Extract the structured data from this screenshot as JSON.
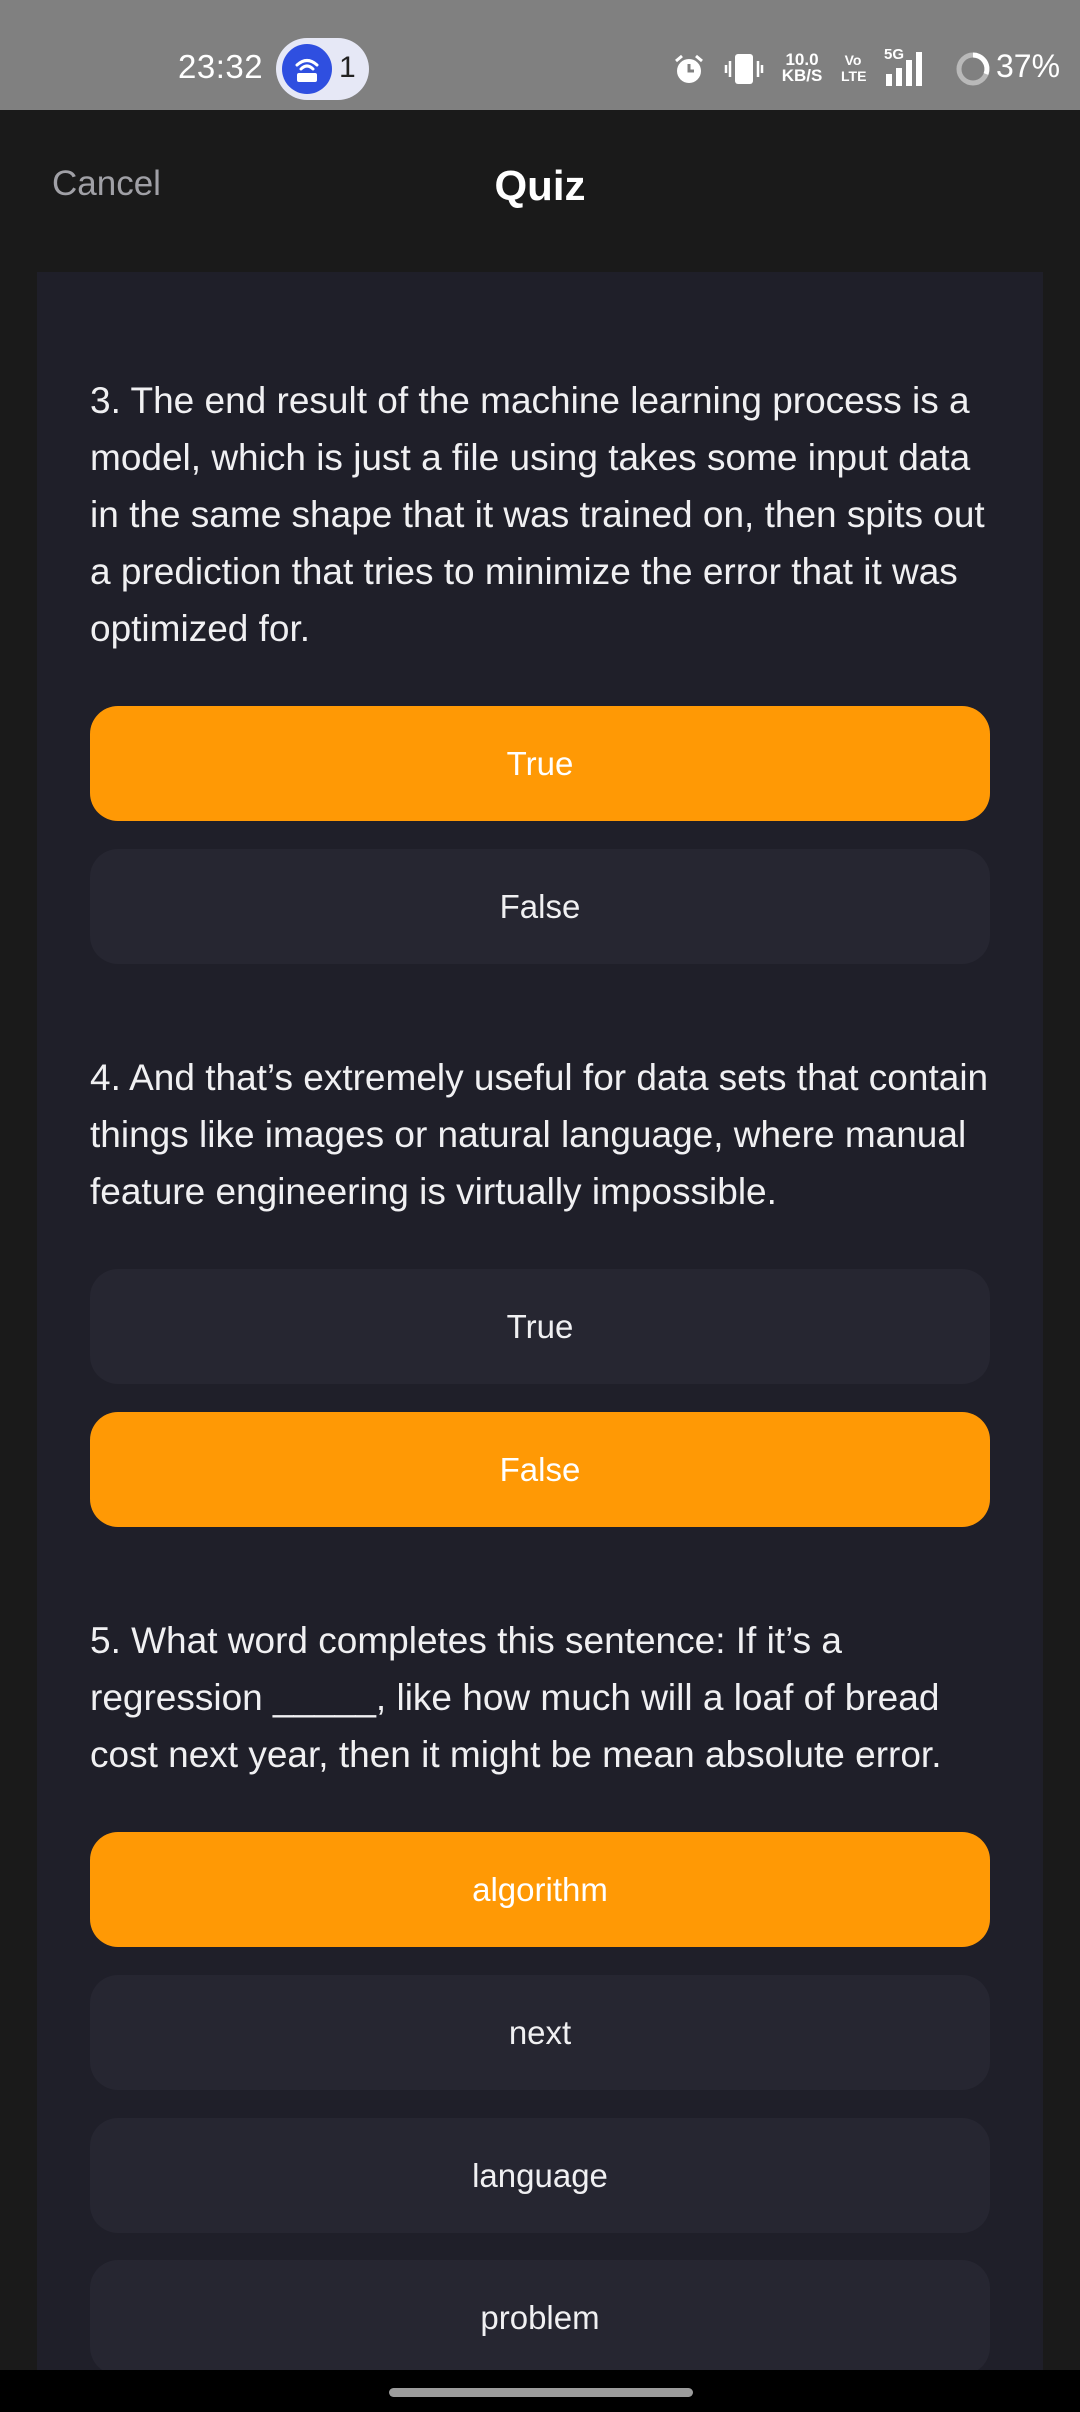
{
  "status_bar": {
    "time": "23:32",
    "hotspot_count": "1",
    "net_speed_value": "10.0",
    "net_speed_unit": "KB/S",
    "volte_top": "Vo",
    "volte_bottom": "LTE",
    "network": "5G",
    "battery": "37%",
    "icons": [
      "hotspot-icon",
      "alarm-icon",
      "vibrate-icon",
      "signal-icon",
      "battery-ring-icon"
    ]
  },
  "header": {
    "cancel_label": "Cancel",
    "title": "Quiz"
  },
  "quiz": {
    "questions": [
      {
        "text": "3. The end result of the machine learning process is a model, which is just a file using takes some input data in the same shape that it was trained on, then spits out a prediction that tries to minimize the error that it was optimized for.",
        "options": [
          {
            "label": "True",
            "selected": true
          },
          {
            "label": "False",
            "selected": false
          }
        ]
      },
      {
        "text": "4. And that’s extremely useful for data sets that contain things like images or natural language, where manual feature engineering is virtually impossible.",
        "options": [
          {
            "label": "True",
            "selected": false
          },
          {
            "label": "False",
            "selected": true
          }
        ]
      },
      {
        "text": "5. What word completes this sentence: If it’s a regression _____, like how much will a loaf of bread cost next year, then it might be mean absolute error.",
        "options": [
          {
            "label": "algorithm",
            "selected": true
          },
          {
            "label": "next",
            "selected": false
          },
          {
            "label": "language",
            "selected": false
          },
          {
            "label": "problem",
            "selected": false
          }
        ]
      }
    ]
  },
  "colors": {
    "accent": "#ff9905",
    "panel": "#1f1f29",
    "option_bg": "#262631",
    "background": "#1a1a1a",
    "status_bar": "#808080"
  }
}
